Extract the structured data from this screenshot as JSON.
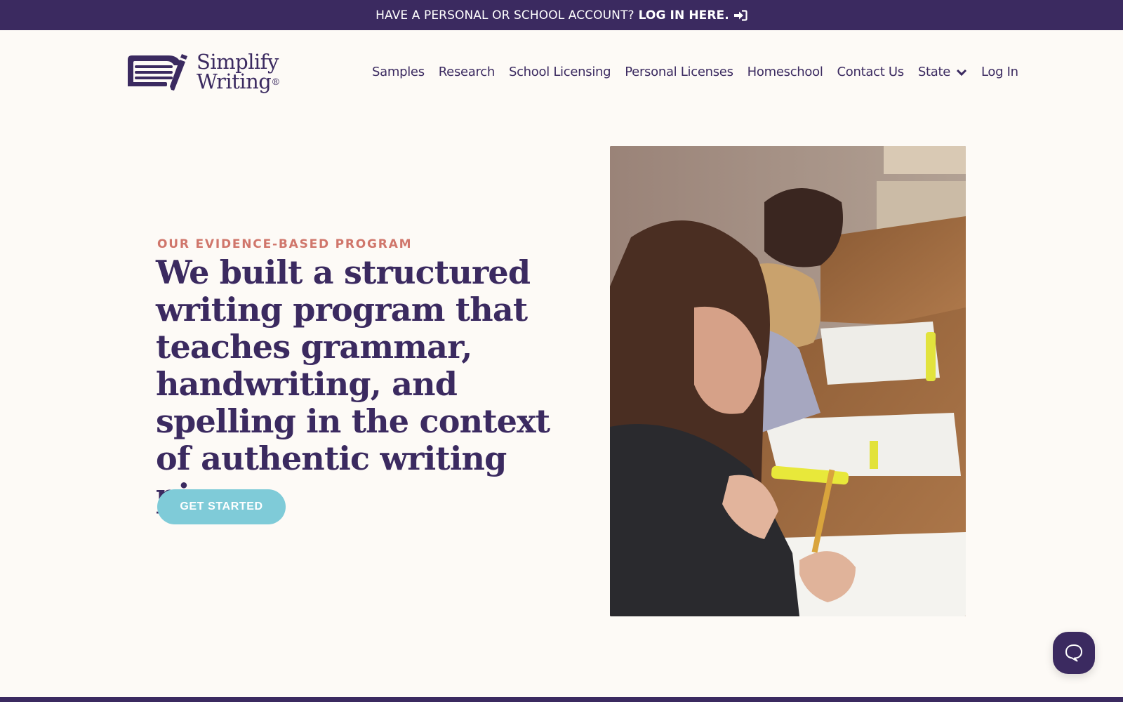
{
  "announcement": {
    "question": "HAVE A PERSONAL OR SCHOOL ACCOUNT?",
    "link_label": "LOG IN HERE.",
    "icon": "sign-in-icon"
  },
  "brand": {
    "line1": "Simplify",
    "line2": "Writing",
    "registered": "®",
    "icon": "notebook-pencil-logo-icon"
  },
  "nav": {
    "items": [
      {
        "label": "Samples"
      },
      {
        "label": "Research"
      },
      {
        "label": "School Licensing"
      },
      {
        "label": "Personal Licenses"
      },
      {
        "label": "Homeschool"
      },
      {
        "label": "Contact Us"
      },
      {
        "label": "State",
        "icon": "chevron-down-icon"
      },
      {
        "label": "Log In"
      }
    ]
  },
  "hero": {
    "eyebrow": "OUR EVIDENCE-BASED PROGRAM",
    "headline": "We built a structured writing program that teaches grammar, handwriting, and spelling in the context of authentic writing pieces.",
    "cta_label": "GET STARTED",
    "image_alt": "Students writing at desks in a classroom"
  },
  "chat": {
    "icon": "chat-bubble-icon"
  },
  "colors": {
    "primary": "#3b2a60",
    "accent_coral": "#d0766b",
    "cta_teal": "#7fcbd8",
    "background": "#fdfaf6"
  }
}
